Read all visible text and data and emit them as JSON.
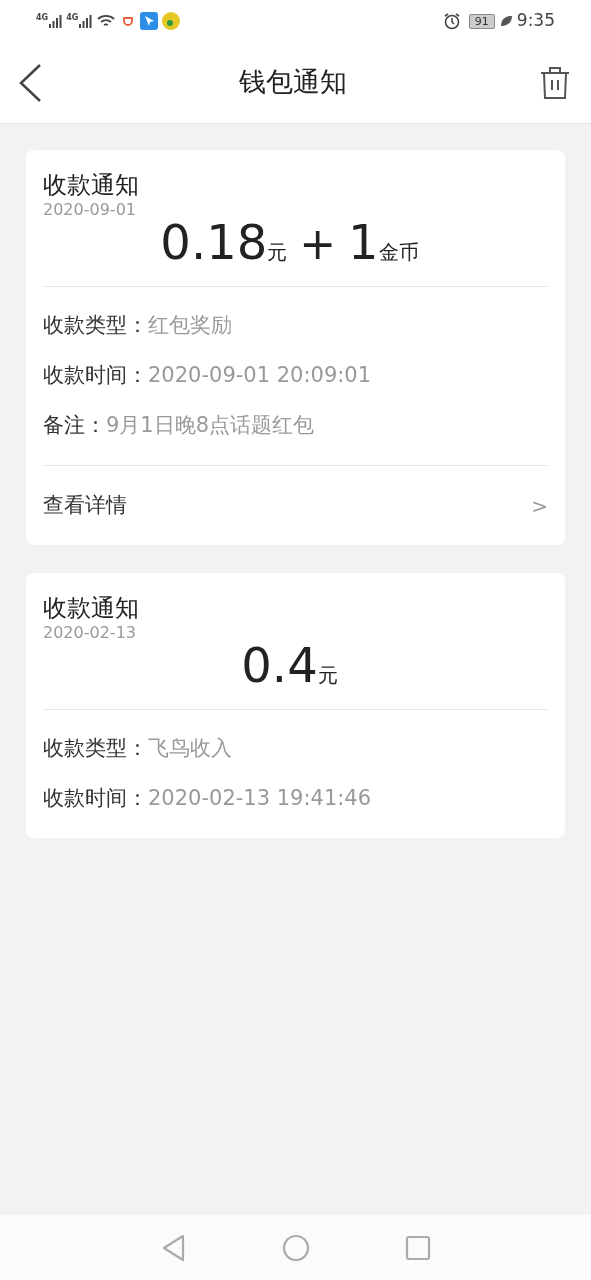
{
  "status_bar": {
    "network": [
      "4G",
      "4G"
    ],
    "battery": "91",
    "time": "9:35"
  },
  "header": {
    "title": "钱包通知"
  },
  "cards": [
    {
      "title": "收款通知",
      "date": "2020-09-01",
      "amount": [
        {
          "kind": "num",
          "text": "0.18"
        },
        {
          "kind": "unit",
          "text": "元"
        },
        {
          "kind": "op",
          "text": "+"
        },
        {
          "kind": "num",
          "text": "1"
        },
        {
          "kind": "unit",
          "text": "金币"
        }
      ],
      "rows": [
        {
          "label": "收款类型：",
          "value": "红包奖励"
        },
        {
          "label": "收款时间：",
          "value": "2020-09-01 20:09:01"
        },
        {
          "label": "备注：",
          "value": "9月1日晚8点话题红包"
        }
      ],
      "link": {
        "label": "查看详情",
        "arrow": ">"
      }
    },
    {
      "title": "收款通知",
      "date": "2020-02-13",
      "amount": [
        {
          "kind": "num",
          "text": "0.4"
        },
        {
          "kind": "unit",
          "text": "元"
        }
      ],
      "rows": [
        {
          "label": "收款类型：",
          "value": "飞鸟收入"
        },
        {
          "label": "收款时间：",
          "value": "2020-02-13 19:41:46"
        }
      ]
    }
  ]
}
